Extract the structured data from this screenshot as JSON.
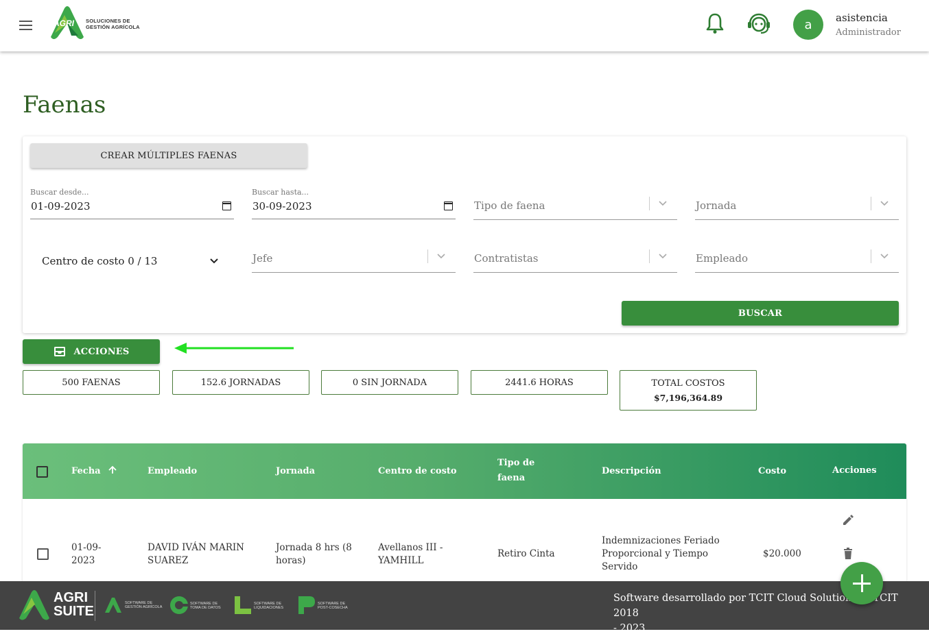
{
  "header": {
    "logo_text_line1": "SOLUCIONES DE",
    "logo_text_line2": "GESTIÓN AGRÍCOLA",
    "logo_mark": "AGRI",
    "user_initial": "a",
    "user_name": "asistencia",
    "user_role": "Administrador",
    "icons": [
      "menu-icon",
      "bell-icon",
      "support-agent-icon"
    ]
  },
  "page": {
    "title": "Faenas"
  },
  "filters": {
    "create_multiple_label": "CREAR MÚLTIPLES FAENAS",
    "from_label": "Buscar desde...",
    "from_value": "01-09-2023",
    "to_label": "Buscar hasta...",
    "to_value": "30-09-2023",
    "tipo_faena_placeholder": "Tipo de faena",
    "jornada_placeholder": "Jornada",
    "centro_costo_label": "Centro de costo 0 / 13",
    "jefe_placeholder": "Jefe",
    "contratistas_placeholder": "Contratistas",
    "empleado_placeholder": "Empleado",
    "search_label": "BUSCAR"
  },
  "actions": {
    "label": "ACCIONES",
    "arrow_color": "#22e022"
  },
  "stats": {
    "faenas": "500 FAENAS",
    "jornadas": "152.6 JORNADAS",
    "sin_jornada": "0 SIN JORNADA",
    "horas": "2441.6 HORAS",
    "total_costos_label": "TOTAL COSTOS",
    "total_costos_value": "$7,196,364.89"
  },
  "table": {
    "columns": {
      "fecha": "Fecha",
      "empleado": "Empleado",
      "jornada": "Jornada",
      "centro": "Centro de costo",
      "tipo_line1": "Tipo de",
      "tipo_line2": "faena",
      "descripcion": "Descripción",
      "costo": "Costo",
      "acciones": "Acciones"
    },
    "rows": [
      {
        "fecha_l1": "01-09-",
        "fecha_l2": "2023",
        "empleado_l1": "DAVID IVÁN MARIN",
        "empleado_l2": "SUAREZ",
        "jornada_l1": "Jornada 8 hrs (8",
        "jornada_l2": "horas)",
        "centro_l1": "Avellanos III -",
        "centro_l2": "YAMHILL",
        "tipo": "Retiro Cinta",
        "desc_l1": "Indemnizaciones Feriado",
        "desc_l2": "Proporcional y Tiempo",
        "desc_l3": "Servido",
        "costo": "$20.000"
      }
    ]
  },
  "footer": {
    "brand_top": "AGRI",
    "brand_bottom": "SUITE",
    "products": [
      {
        "mark": "AGRI",
        "text1": "SOFTWARE DE",
        "text2": "GESTIÓN AGRÍCOLA"
      },
      {
        "mark": "GIVANT",
        "text1": "SOFTWARE DE",
        "text2": "TOMA DE DATOS"
      },
      {
        "mark": "LIKIT",
        "text1": "SOFTWARE DE",
        "text2": "LIQUIDACIONES"
      },
      {
        "mark": "PAKIT",
        "text1": "SOFTWARE DE",
        "text2": "POST-COSECHA"
      }
    ],
    "credit_line1": "Software desarrollado por TCIT Cloud Solutions © TCIT 2018",
    "credit_line2": "- 2023"
  },
  "colors": {
    "primary_green": "#388e3c",
    "title_green": "#2e5e22",
    "footer_bg": "#434343"
  }
}
